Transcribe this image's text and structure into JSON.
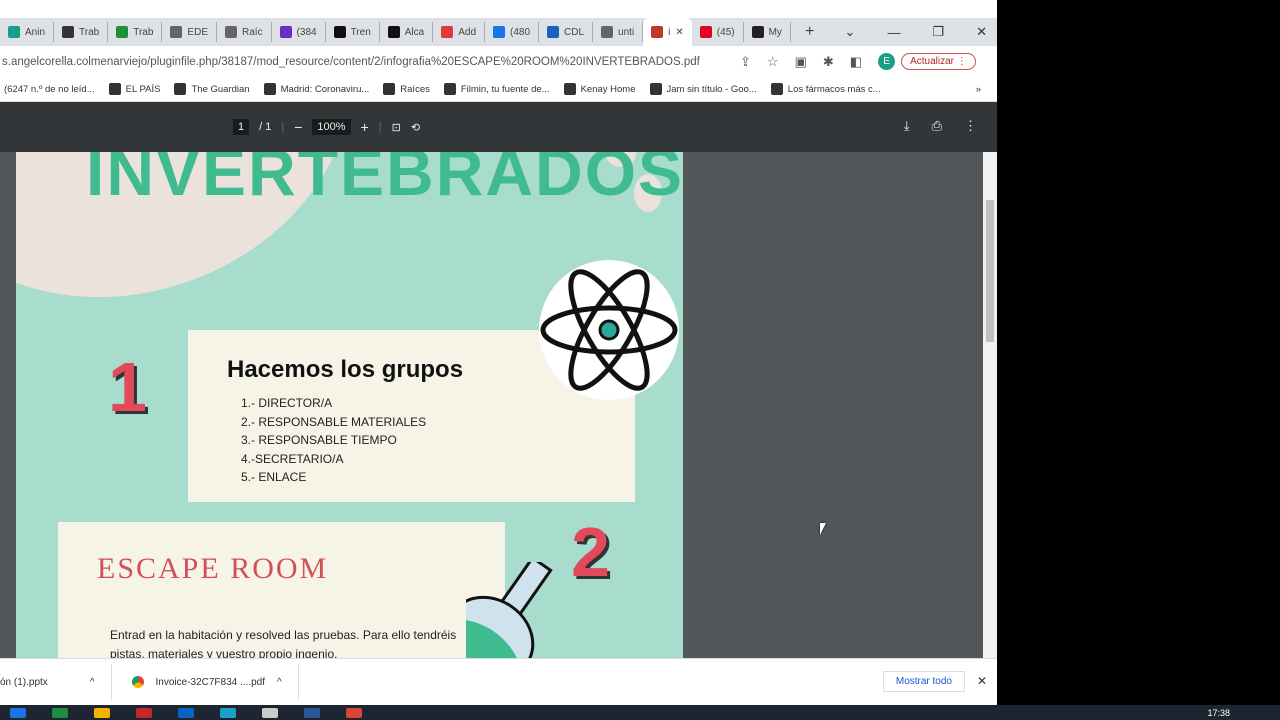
{
  "tabs": [
    {
      "label": "Anin",
      "color": "#1a9e8a"
    },
    {
      "label": "Trab",
      "color": "#333"
    },
    {
      "label": "Trab",
      "color": "#1e8e3e"
    },
    {
      "label": "EDE",
      "color": "#666"
    },
    {
      "label": "Raíc",
      "color": "#666"
    },
    {
      "label": "(384",
      "color": "#6b2fbf"
    },
    {
      "label": "Tren",
      "color": "#111"
    },
    {
      "label": "Alca",
      "color": "#111"
    },
    {
      "label": "Add",
      "color": "#e0393e"
    },
    {
      "label": "(480",
      "color": "#1a73e8"
    },
    {
      "label": "CDL",
      "color": "#1565c0"
    },
    {
      "label": "unti",
      "color": "#666"
    },
    {
      "label": "i",
      "color": "#c0392b",
      "active": true
    },
    {
      "label": "(45)",
      "color": "#e60023"
    },
    {
      "label": "My",
      "color": "#222"
    }
  ],
  "window": {
    "new_tab": "+",
    "dropdown": "⌄",
    "minimize": "—",
    "restore": "❐",
    "close": "✕"
  },
  "address": {
    "url": "s.angelcorella.colmenarviejo/pluginfile.php/38187/mod_resource/content/2/infografia%20ESCAPE%20ROOM%20INVERTEBRADOS.pdf",
    "avatar": "E",
    "update": "Actualizar"
  },
  "bookmarks": [
    "(6247 n.º de no leíd...",
    "EL PAÍS",
    "The Guardian",
    "Madrid: Coronaviru...",
    "Raíces",
    "Filmin, tu fuente de...",
    "Kenay Home",
    "Jam sin título - Goo...",
    "Los fármacos más c..."
  ],
  "bookmarks_more": "»",
  "pdf": {
    "page": "1",
    "total": "/ 1",
    "zoom": "100%"
  },
  "doc": {
    "title": "INVERTEBRADOS",
    "num1": "1",
    "card1_title": "Hacemos los grupos",
    "items": [
      "1.- DIRECTOR/A",
      "2.- RESPONSABLE MATERIALES",
      "3.- RESPONSABLE TIEMPO",
      "4.-SECRETARIO/A",
      "5.- ENLACE"
    ],
    "num2": "2",
    "card2_title": "ESCAPE ROOM",
    "card2_text": "Entrad en la habitación y resolved las pruebas. Para ello tendréis pistas, materiales y vuestro propio ingenio."
  },
  "downloads": {
    "items": [
      "ón (1).pptx",
      "Invoice-32C7F834 ....pdf"
    ],
    "show_all": "Mostrar todo",
    "close": "✕"
  },
  "taskbar": {
    "time": "17:38"
  }
}
